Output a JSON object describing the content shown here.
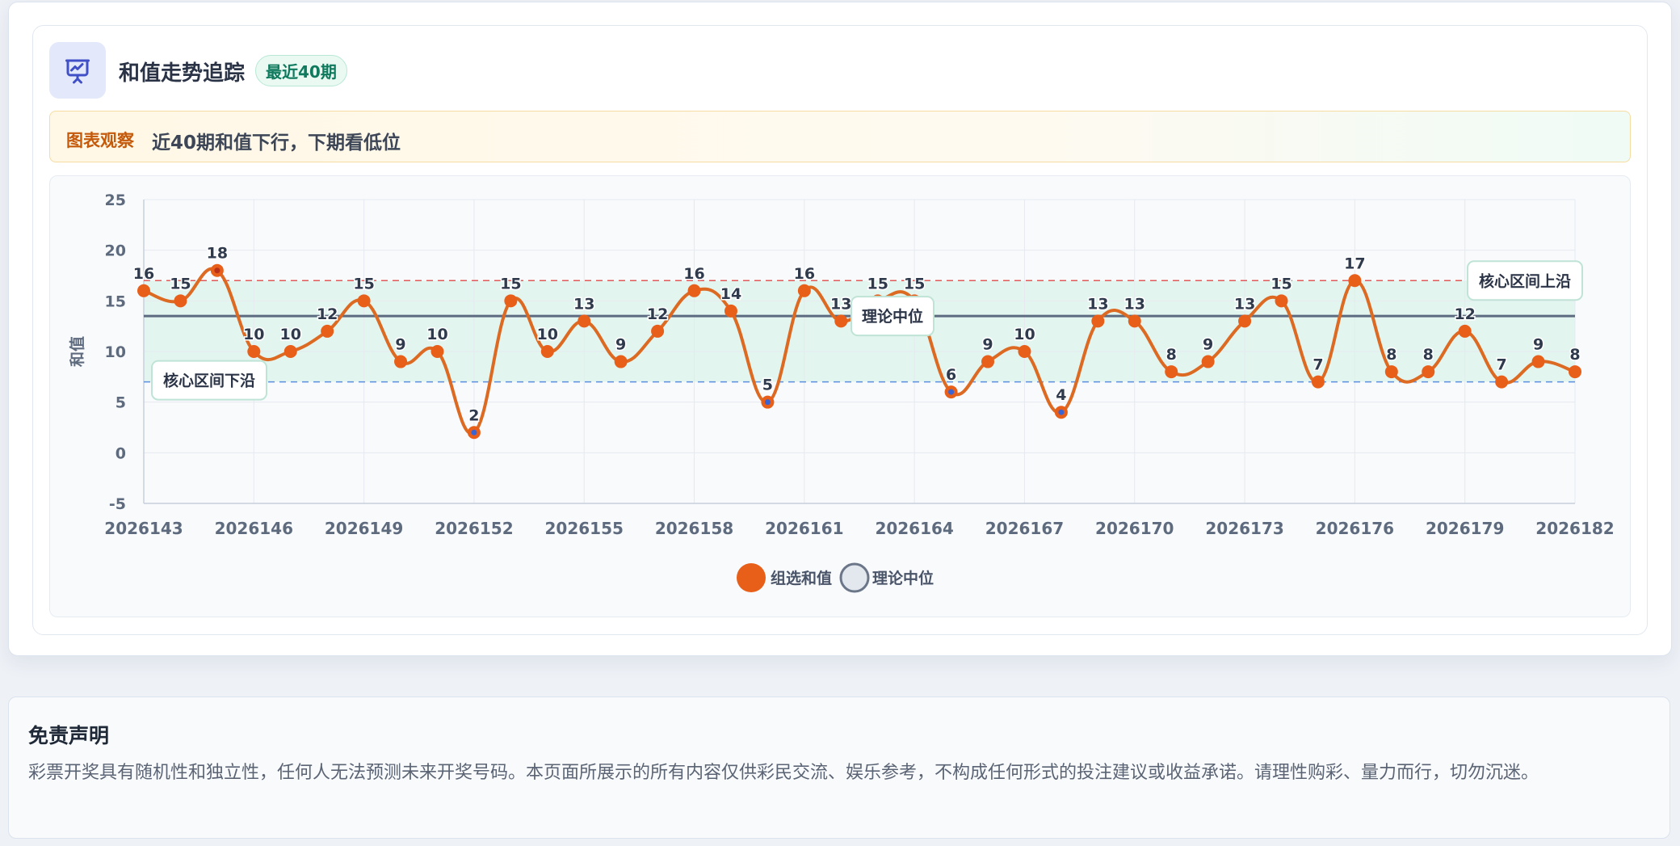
{
  "header": {
    "title": "和值走势追踪",
    "badge": "最近40期"
  },
  "insight": {
    "label": "图表观察",
    "text": "近40期和值下行，下期看低位"
  },
  "disclaimer": {
    "title": "免责声明",
    "text": "彩票开奖具有随机性和独立性，任何人无法预测未来开奖号码。本页面所展示的所有内容仅供彩民交流、娱乐参考，不构成任何形式的投注建议或收益承诺。请理性购彩、量力而行，切勿沉迷。"
  },
  "colors": {
    "line": "#dd6a22",
    "point": "#e85f1a",
    "low_point_center": "#3b63d1",
    "band": "#dff3ec",
    "upper_line": "#e05a5a",
    "lower_line": "#5b8fe0",
    "median_line": "#5d6b80"
  },
  "chart_data": {
    "type": "line",
    "ylabel": "和值",
    "xlabel": "",
    "ylim": [
      -5,
      25
    ],
    "yticks": [
      -5,
      0,
      5,
      10,
      15,
      20,
      25
    ],
    "x": [
      "2026143",
      "2026144",
      "2026145",
      "2026146",
      "2026147",
      "2026148",
      "2026149",
      "2026150",
      "2026151",
      "2026152",
      "2026153",
      "2026154",
      "2026155",
      "2026156",
      "2026157",
      "2026158",
      "2026159",
      "2026160",
      "2026161",
      "2026162",
      "2026163",
      "2026164",
      "2026165",
      "2026166",
      "2026167",
      "2026168",
      "2026169",
      "2026170",
      "2026171",
      "2026172",
      "2026173",
      "2026174",
      "2026175",
      "2026176",
      "2026177",
      "2026178",
      "2026179",
      "2026180",
      "2026181",
      "2026182"
    ],
    "xtick_labels": [
      "2026143",
      "2026146",
      "2026149",
      "2026152",
      "2026155",
      "2026158",
      "2026161",
      "2026164",
      "2026167",
      "2026170",
      "2026173",
      "2026176",
      "2026179",
      "2026182"
    ],
    "series": [
      {
        "name": "组选和值",
        "values": [
          16,
          15,
          18,
          10,
          10,
          12,
          15,
          9,
          10,
          2,
          15,
          10,
          13,
          9,
          12,
          16,
          14,
          5,
          16,
          13,
          15,
          15,
          6,
          9,
          10,
          4,
          13,
          13,
          8,
          9,
          13,
          15,
          7,
          17,
          8,
          8,
          12,
          7,
          9,
          8
        ]
      }
    ],
    "median": 13.5,
    "band_upper": 17,
    "band_lower": 7,
    "annotations": {
      "upper": "核心区间上沿",
      "lower": "核心区间下沿",
      "median": "理论中位"
    },
    "legend": [
      "组选和值",
      "理论中位"
    ],
    "legend_position": "bottom",
    "grid": true
  }
}
